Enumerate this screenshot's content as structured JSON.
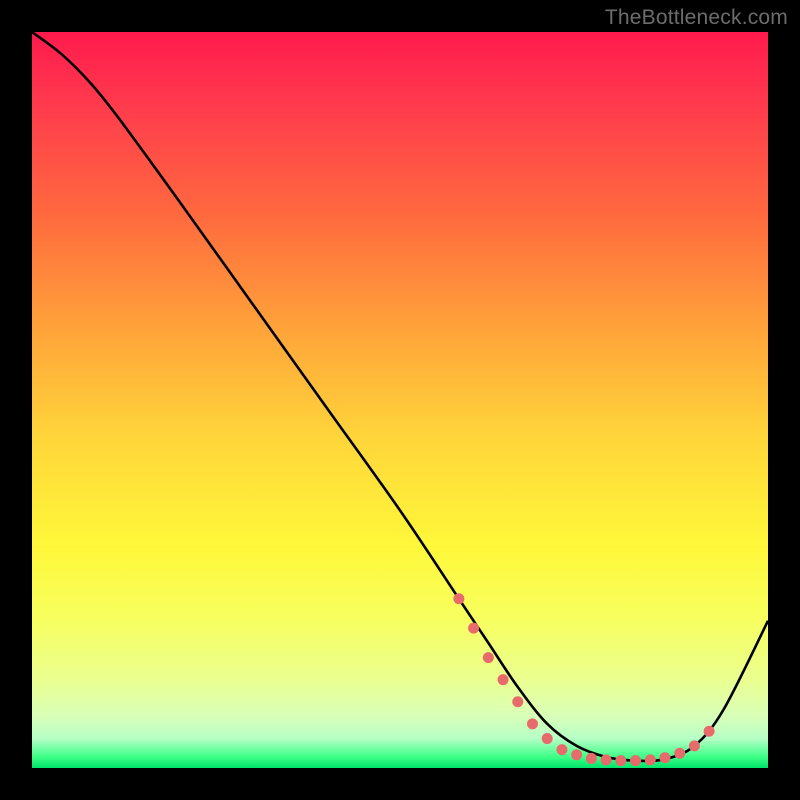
{
  "watermark": "TheBottleneck.com",
  "chart_data": {
    "type": "line",
    "title": "",
    "xlabel": "",
    "ylabel": "",
    "xlim": [
      0,
      100
    ],
    "ylim": [
      0,
      100
    ],
    "grid": false,
    "legend": false,
    "background": "vertical-gradient red→yellow→green",
    "series": [
      {
        "name": "bottleneck-curve",
        "x": [
          0,
          4,
          8,
          12,
          20,
          30,
          40,
          50,
          58,
          62,
          66,
          70,
          74,
          78,
          82,
          86,
          90,
          94,
          100
        ],
        "y": [
          100,
          97,
          93,
          88,
          77,
          63,
          49,
          35,
          23,
          17,
          11,
          6,
          3,
          1.5,
          1,
          1.2,
          3,
          8,
          20
        ]
      }
    ],
    "markers": {
      "name": "highlight-dots",
      "color": "#e86b6b",
      "x": [
        58,
        60,
        62,
        64,
        66,
        68,
        70,
        72,
        74,
        76,
        78,
        80,
        82,
        84,
        86,
        88,
        90,
        92
      ],
      "y": [
        23,
        19,
        15,
        12,
        9,
        6,
        4,
        2.5,
        1.8,
        1.3,
        1.1,
        1.0,
        1.0,
        1.1,
        1.4,
        2.0,
        3.0,
        5.0
      ]
    }
  }
}
